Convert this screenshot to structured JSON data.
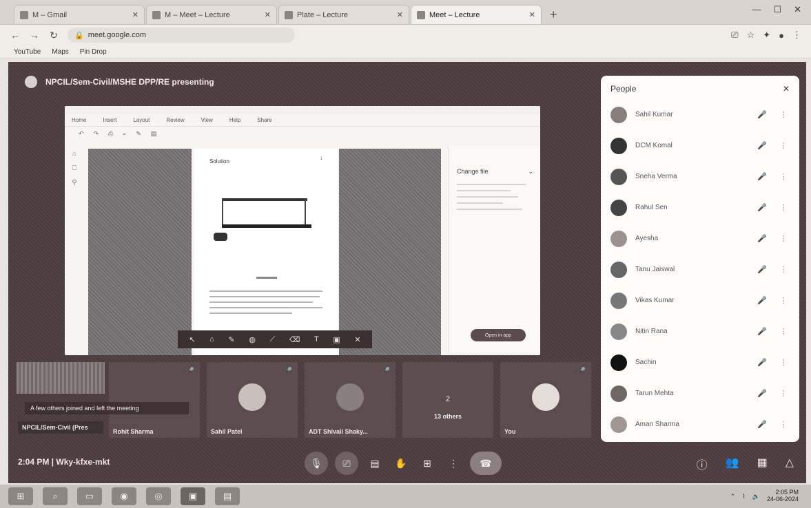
{
  "browser": {
    "tabs": [
      {
        "label": "M – Gmail",
        "active": false
      },
      {
        "label": "M – Meet – Lecture",
        "active": false
      },
      {
        "label": "Plate – Lecture",
        "active": false
      },
      {
        "label": "Meet – Lecture",
        "active": true
      }
    ],
    "new_tab": "+",
    "url": "meet.google.com",
    "bookmarks": [
      "YouTube",
      "Maps",
      "Pin Drop"
    ]
  },
  "meet": {
    "meeting_title": "NPCIL/Sem-Civil/MSHE DPP/RE presenting",
    "shared_doc": {
      "menu": [
        "Home",
        "Insert",
        "Layout",
        "Review",
        "View",
        "Help",
        "Share"
      ],
      "heading": "Solution",
      "page_number": "1",
      "side_panel_select": "Change file",
      "side_panel_button": "Open in app"
    },
    "notification": "A few others joined and left the meeting",
    "presenting_label": "NPCIL/Sem-Civil (Pres",
    "tiles": [
      {
        "name": "Rohit Sharma"
      },
      {
        "name": "Sahil Patel"
      },
      {
        "name": "ADT Shivali Shaky..."
      },
      {
        "name": "You"
      }
    ],
    "others_tile": {
      "count": "2",
      "label": "13 others"
    },
    "clock": "2:04 PM | Wky-kfxe-mkt"
  },
  "people": {
    "title": "People",
    "participants": [
      {
        "name": "Sahil Kumar"
      },
      {
        "name": "DCM Komal"
      },
      {
        "name": "Sneha Verma"
      },
      {
        "name": "Rahul Sen"
      },
      {
        "name": "Ayesha"
      },
      {
        "name": "Tanu Jaiswal"
      },
      {
        "name": "Vikas Kumar"
      },
      {
        "name": "Nitin Rana"
      },
      {
        "name": "Sachin"
      },
      {
        "name": "Tarun Mehta"
      },
      {
        "name": "Aman Sharma"
      }
    ]
  },
  "taskbar": {
    "time": "2:05 PM",
    "date": "24-06-2024"
  },
  "colors": {
    "meet_bg": "#4d3d40",
    "panel_bg": "#fdfcfb"
  }
}
